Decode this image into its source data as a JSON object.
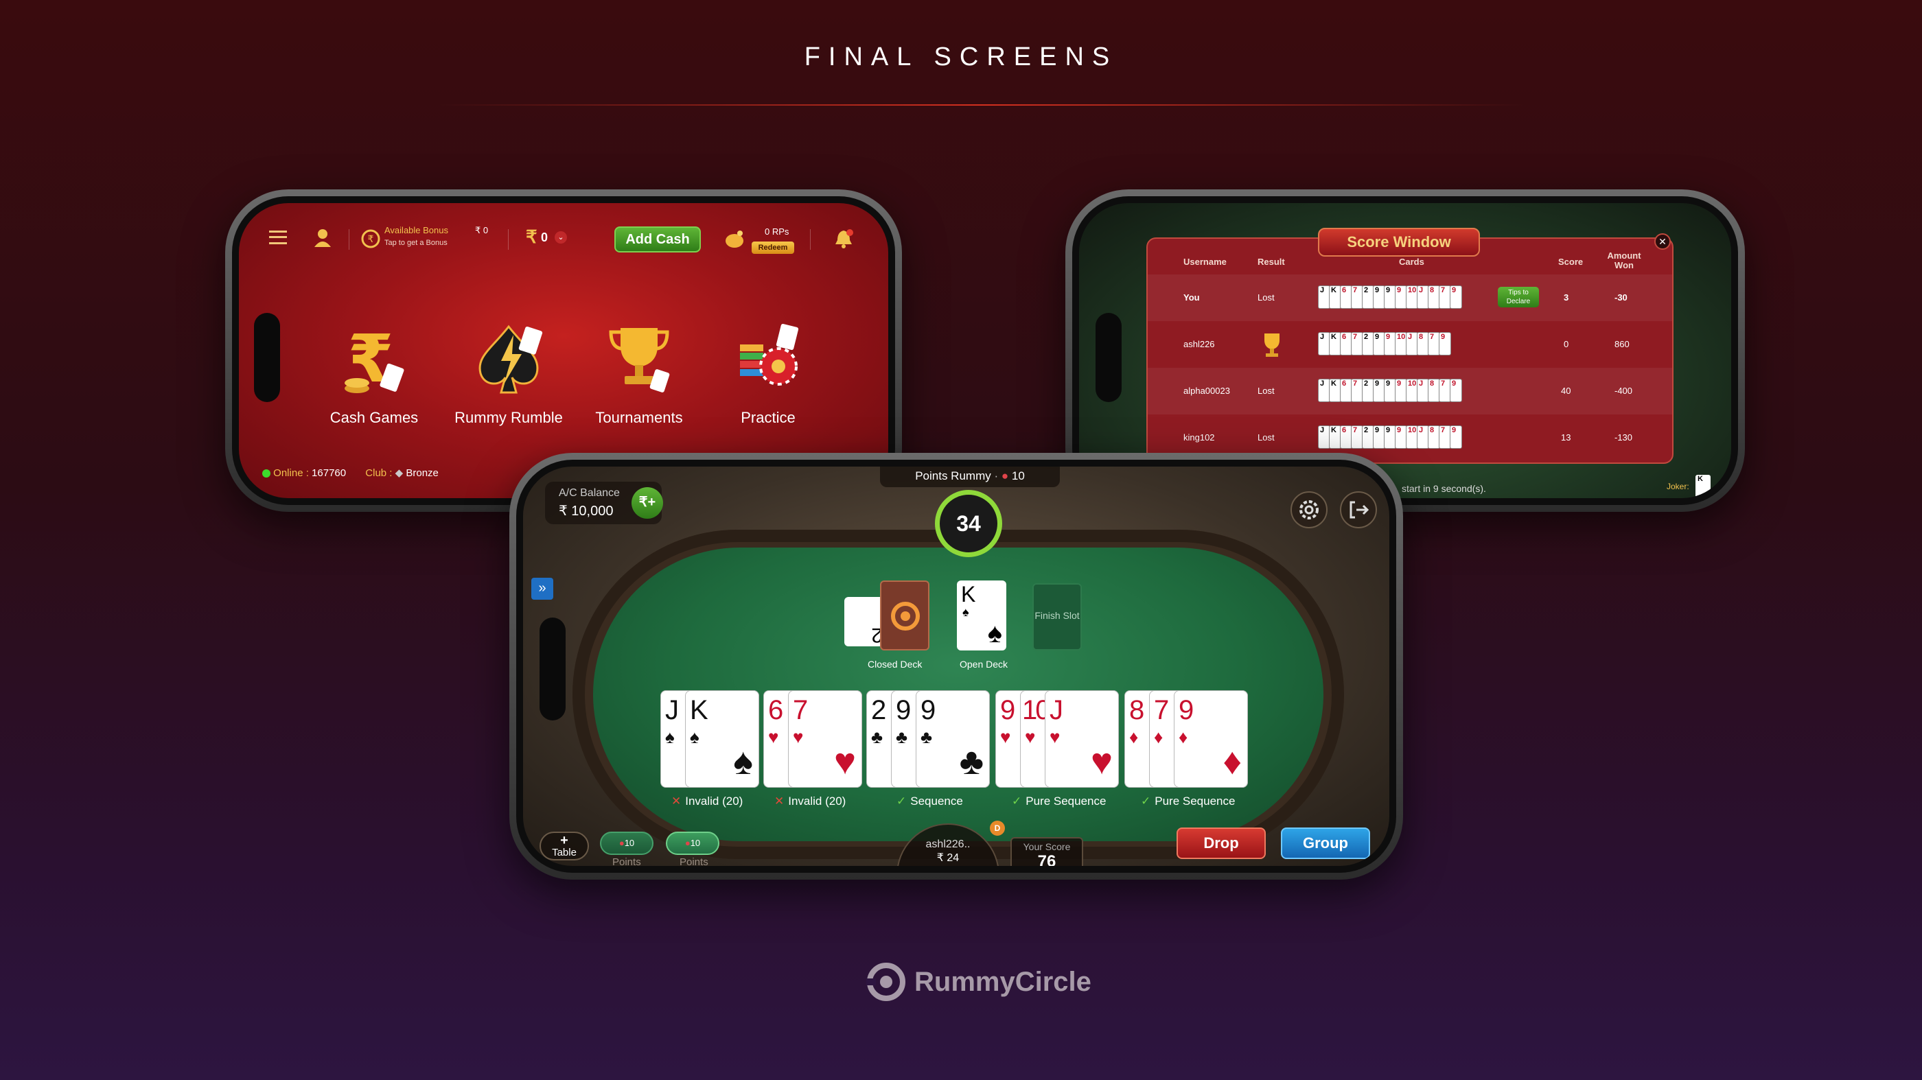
{
  "heading": "FINAL SCREENS",
  "lobby": {
    "bonus_label": "Available Bonus",
    "bonus_value": "₹ 0",
    "bonus_sub": "Tap to get a Bonus",
    "cash_value": "0",
    "add_cash": "Add Cash",
    "rps": "0 RPs",
    "redeem": "Redeem",
    "games": [
      {
        "label": "Cash Games"
      },
      {
        "label": "Rummy Rumble"
      },
      {
        "label": "Tournaments"
      },
      {
        "label": "Practice"
      }
    ],
    "online_label": "Online :",
    "online_value": "167760",
    "club_label": "Club :",
    "club_value": "Bronze"
  },
  "score": {
    "title": "Score Window",
    "headers": {
      "username": "Username",
      "result": "Result",
      "cards": "Cards",
      "score": "Score",
      "won": "Amount Won"
    },
    "rows": [
      {
        "user": "You",
        "result": "Lost",
        "score": "3",
        "won": "-30",
        "tips": "Tips to Declare"
      },
      {
        "user": "ashl226",
        "result": "",
        "score": "0",
        "won": "860"
      },
      {
        "user": "alpha00023",
        "result": "Lost",
        "score": "40",
        "won": "-400"
      },
      {
        "user": "king102",
        "result": "Lost",
        "score": "13",
        "won": "-130"
      }
    ],
    "footer": "start in 9 second(s).",
    "joker_label": "Joker:"
  },
  "game": {
    "balance_label": "A/C Balance",
    "balance_value": "₹ 10,000",
    "mode": "Points Rummy",
    "mode_points": "10",
    "timer": "34",
    "closed_deck": "Closed Deck",
    "open_deck": "Open Deck",
    "finish_slot": "Finish Slot",
    "groups": [
      {
        "label": "Invalid (20)"
      },
      {
        "label": "Invalid (20)"
      },
      {
        "label": "Sequence"
      },
      {
        "label": "Pure Sequence"
      },
      {
        "label": "Pure Sequence"
      }
    ],
    "table_label": "Table",
    "chip1_value": "10",
    "chip1_label": "Points",
    "chip2_value": "10",
    "chip2_label": "Points",
    "player_name": "ashl226..",
    "player_amount": "₹ 24",
    "dealer_badge": "D",
    "your_score_label": "Your Score",
    "your_score_value": "76",
    "drop": "Drop",
    "group": "Group"
  },
  "brand": "RummyCircle"
}
